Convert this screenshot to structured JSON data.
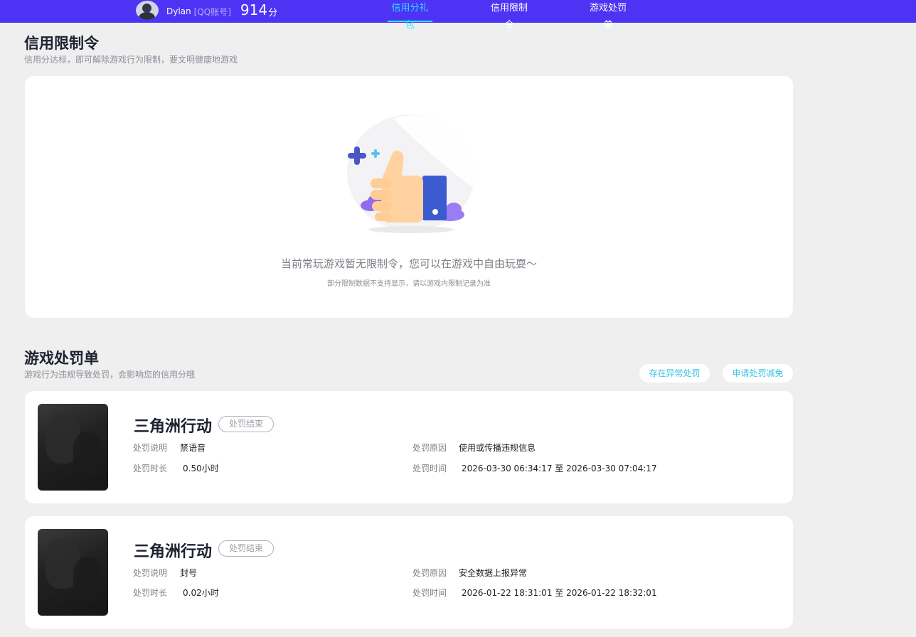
{
  "header": {
    "user_name": "Dylan",
    "account_type": "[QQ账号]",
    "score": "914",
    "score_unit": "分",
    "tabs": [
      {
        "label": "信用分礼包",
        "active": true
      },
      {
        "label": "信用限制令",
        "active": false
      },
      {
        "label": "游戏处罚单",
        "active": false
      }
    ]
  },
  "restriction": {
    "title": "信用限制令",
    "subtitle": "信用分达标，即可解除游戏行为限制，要文明健康地游戏",
    "empty_message": "当前常玩游戏暂无限制令，您可以在游戏中自由玩耍～",
    "empty_note": "部分限制数据不支持显示，请以游戏内限制记录为准"
  },
  "punishment": {
    "title": "游戏处罚单",
    "subtitle": "游戏行为违规导致处罚，会影响您的信用分哦",
    "btn_abnormal": "存在异常处罚",
    "btn_reduce": "申请处罚减免",
    "labels": {
      "desc": "处罚说明",
      "reason": "处罚原因",
      "duration": "处罚时长",
      "time": "处罚时间",
      "to": "至"
    },
    "records": [
      {
        "game": "三角洲行动",
        "status": "处罚结束",
        "desc": "禁语音",
        "reason": "使用或传播违规信息",
        "duration": "0.50小时",
        "start": "2026-03-30 06:34:17",
        "end": "2026-03-30 07:04:17"
      },
      {
        "game": "三角洲行动",
        "status": "处罚结束",
        "desc": "封号",
        "reason": "安全数据上报异常",
        "duration": "0.02小时",
        "start": "2026-01-22 18:31:01",
        "end": "2026-01-22 18:32:01"
      }
    ]
  },
  "colors": {
    "header_bg": "#4f33f5",
    "active_tab": "#27e3ff",
    "link_blue": "#3bc3e6"
  }
}
